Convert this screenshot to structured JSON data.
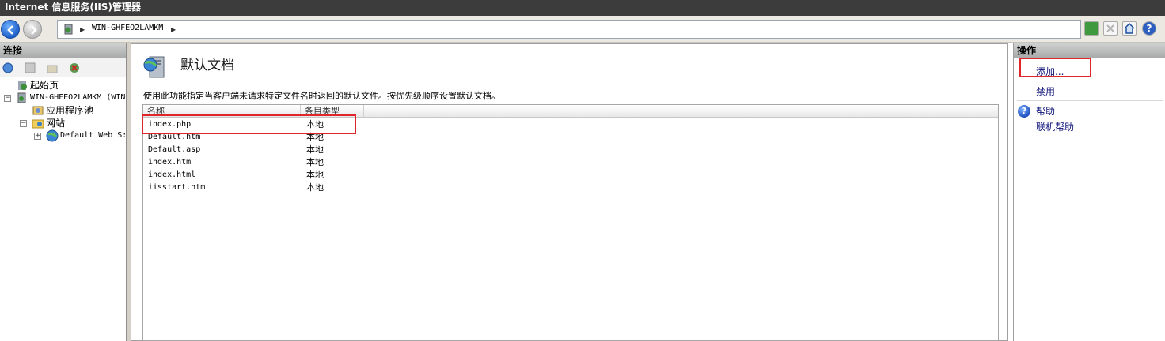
{
  "window": {
    "title": "Internet 信息服务(IIS)管理器"
  },
  "address_bar": {
    "path_node": "WIN-GHFEO2LAMKM"
  },
  "connections": {
    "header": "连接",
    "tree": [
      {
        "label": "起始页"
      },
      {
        "label": "WIN-GHFEO2LAMKM (WIN"
      },
      {
        "label": "应用程序池"
      },
      {
        "label": "网站"
      },
      {
        "label": "Default Web S:"
      }
    ]
  },
  "main": {
    "title": "默认文档",
    "description": "使用此功能指定当客户端未请求特定文件名时返回的默认文件。按优先级顺序设置默认文档。",
    "columns": [
      "名称",
      "条目类型"
    ],
    "rows": [
      {
        "name": "index.php",
        "type": "本地"
      },
      {
        "name": "Default.htm",
        "type": "本地"
      },
      {
        "name": "Default.asp",
        "type": "本地"
      },
      {
        "name": "index.htm",
        "type": "本地"
      },
      {
        "name": "index.html",
        "type": "本地"
      },
      {
        "name": "iisstart.htm",
        "type": "本地"
      }
    ]
  },
  "actions": {
    "header": "操作",
    "add": "添加...",
    "disable": "禁用",
    "help": "帮助",
    "online_help": "联机帮助"
  },
  "colors": {
    "title_bar": "#3c3c3c",
    "highlight_box": "#e0262b",
    "action_link": "#10147a"
  }
}
